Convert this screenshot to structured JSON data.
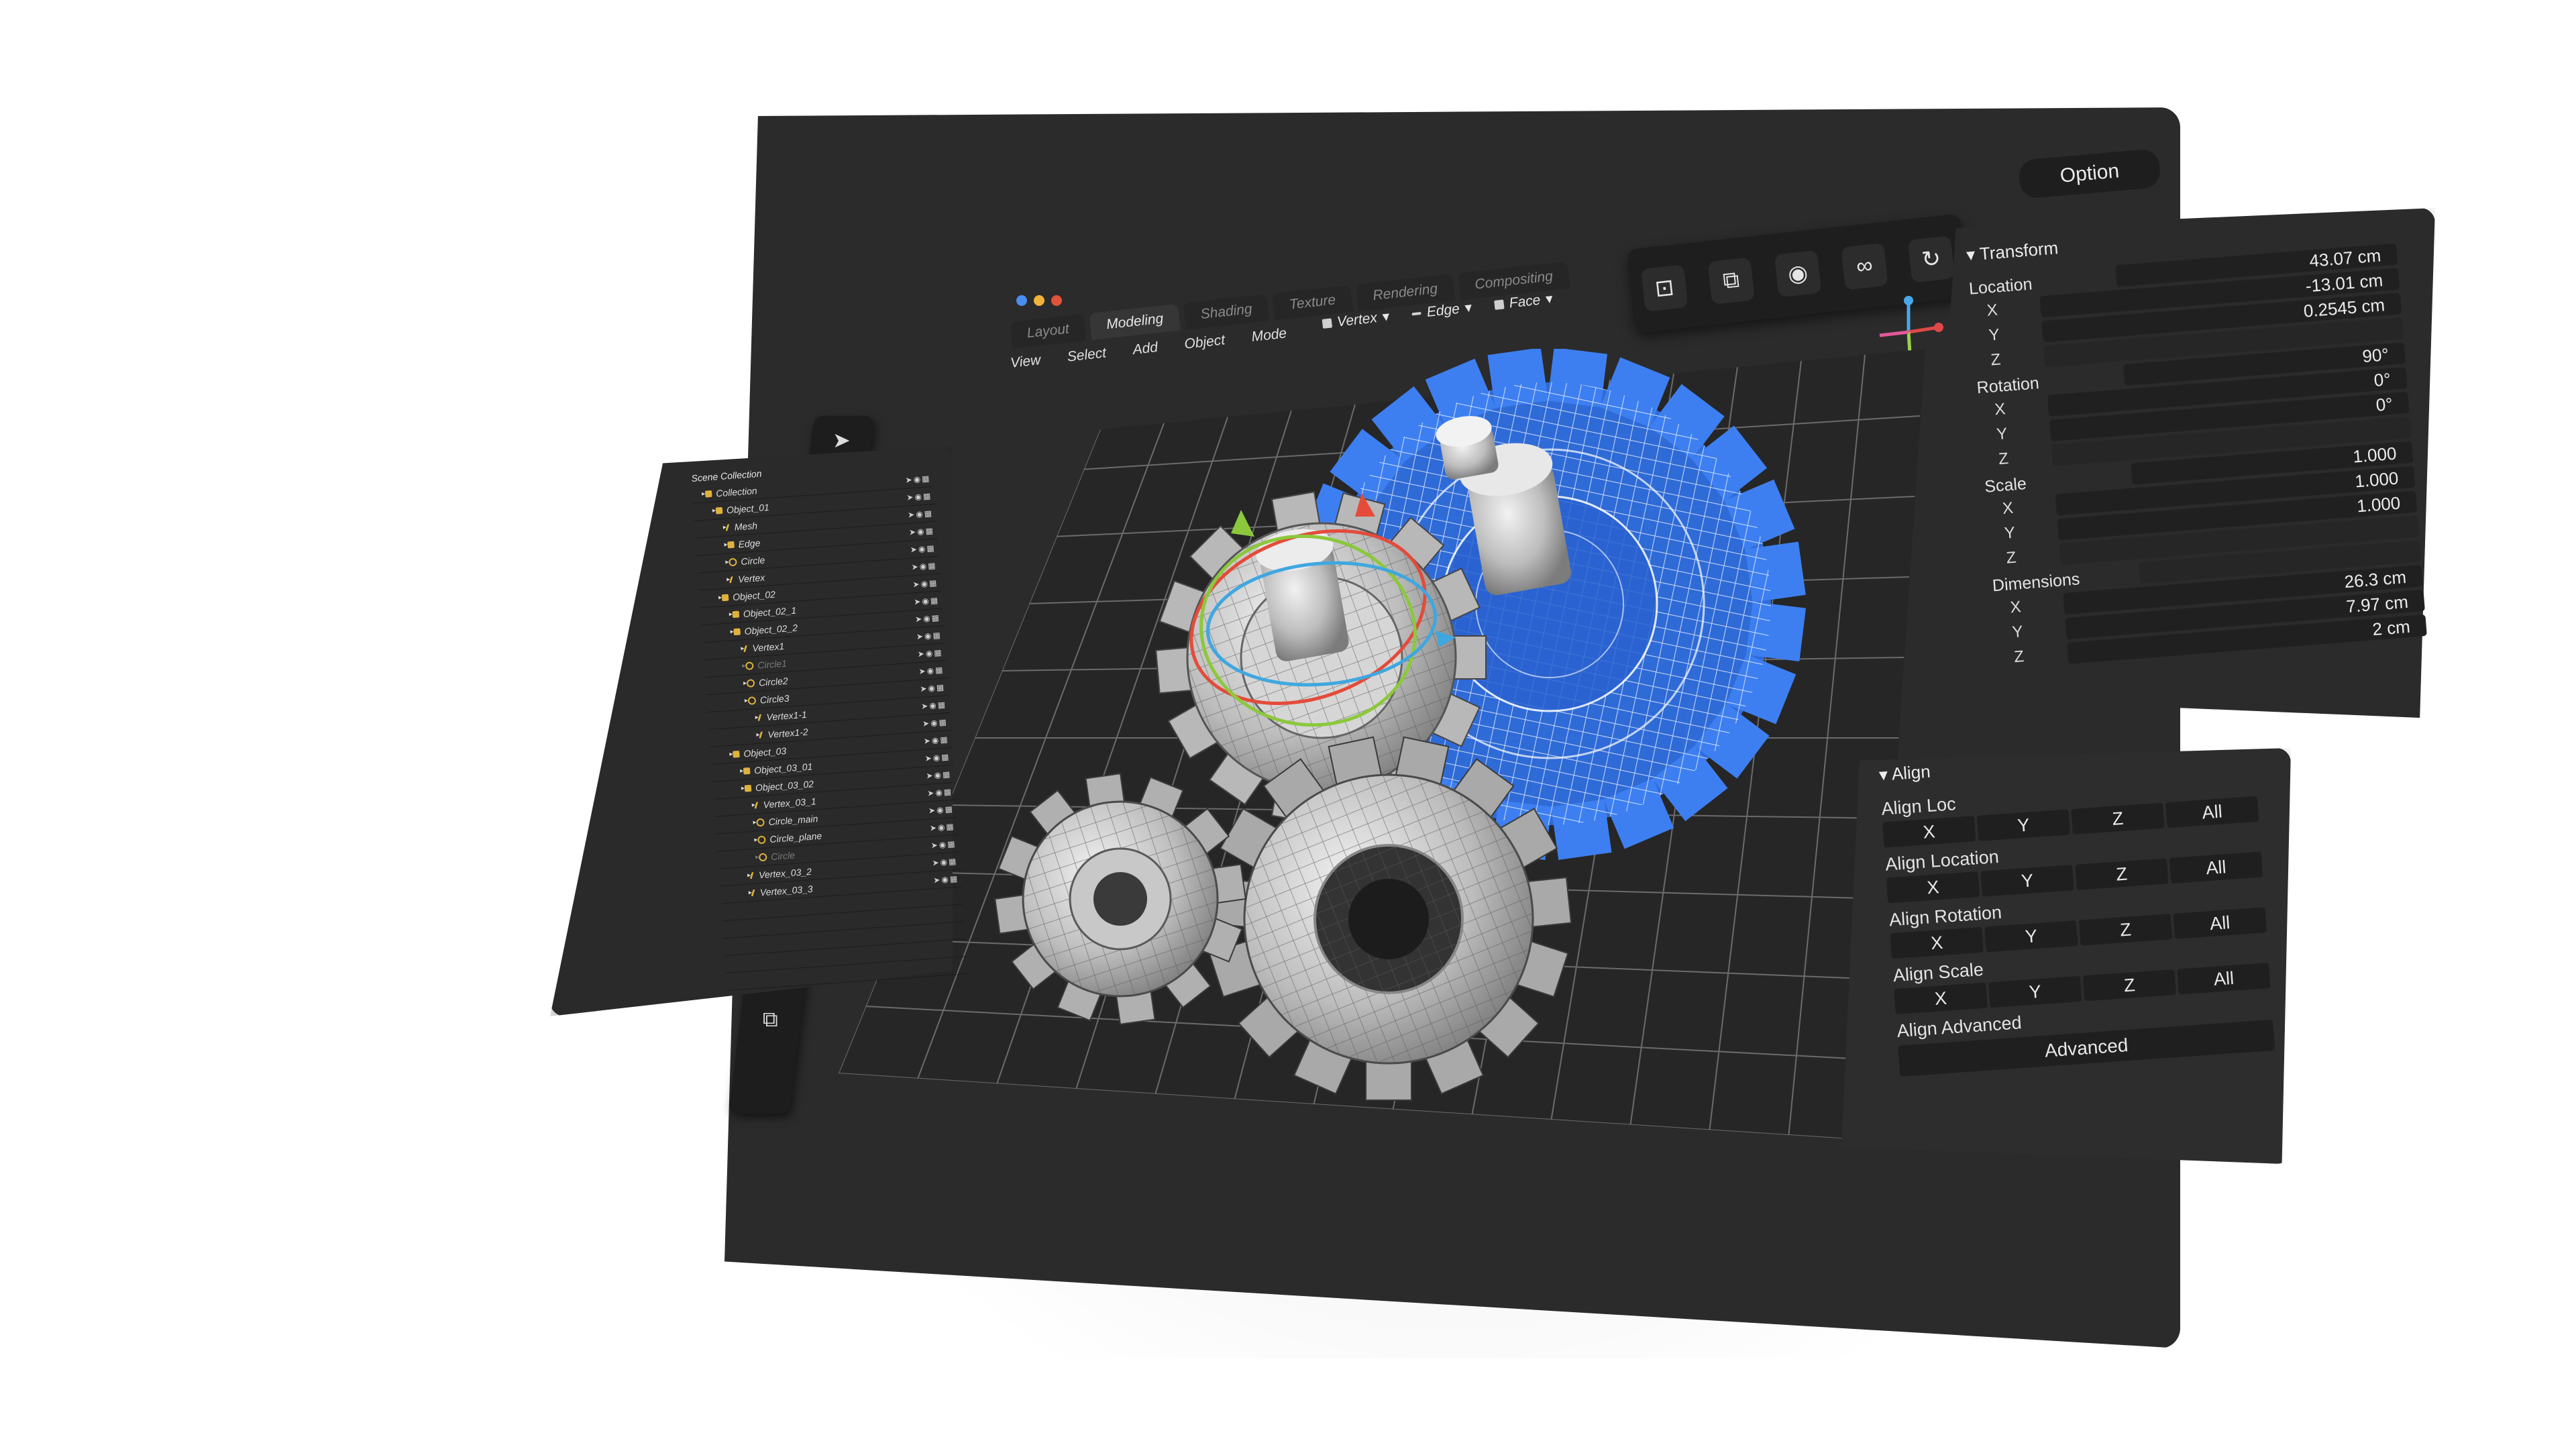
{
  "window": {
    "traffic_lights": [
      "#4a8ef0",
      "#f0b23a",
      "#e0523b"
    ],
    "tabs": [
      {
        "label": "Layout",
        "active": false
      },
      {
        "label": "Modeling",
        "active": true
      },
      {
        "label": "Shading",
        "active": false
      },
      {
        "label": "Texture",
        "active": false
      },
      {
        "label": "Rendering",
        "active": false
      },
      {
        "label": "Compositing",
        "active": false
      }
    ],
    "menus": [
      "View",
      "Select",
      "Add",
      "Object",
      "Mode"
    ],
    "select_modes": [
      "Vertex",
      "Edge",
      "Face"
    ],
    "option_label": "Option",
    "toolbar_icons": [
      "snap-icon",
      "proportional-icon",
      "pivot-icon",
      "link-icon",
      "refresh-icon"
    ]
  },
  "left_toolbar": {
    "icons": [
      "select-arrow-icon",
      "zoom-icon",
      "move-icon",
      "rotate-icon",
      "scale-icon",
      "transform-icon",
      "annotate-icon",
      "measure-icon",
      "extrude-icon",
      "bevel-icon",
      "knife-icon",
      "snap-icon",
      "duplicate-icon"
    ]
  },
  "scene_collection": {
    "title": "Scene Collection",
    "items": [
      {
        "label": "Collection",
        "icon": "folder",
        "dim": false
      },
      {
        "label": "Object_01",
        "icon": "folder",
        "dim": false
      },
      {
        "label": "Mesh",
        "icon": "vert",
        "dim": false
      },
      {
        "label": "Edge",
        "icon": "square",
        "dim": false
      },
      {
        "label": "Circle",
        "icon": "circle",
        "dim": false
      },
      {
        "label": "Vertex",
        "icon": "vert",
        "dim": false
      },
      {
        "label": "Object_02",
        "icon": "folder",
        "dim": false
      },
      {
        "label": "Object_02_1",
        "icon": "folder",
        "dim": false
      },
      {
        "label": "Object_02_2",
        "icon": "folder",
        "dim": false
      },
      {
        "label": "Vertex1",
        "icon": "vert",
        "dim": false
      },
      {
        "label": "Circle1",
        "icon": "circle",
        "dim": true
      },
      {
        "label": "Circle2",
        "icon": "circle",
        "dim": false
      },
      {
        "label": "Circle3",
        "icon": "circle",
        "dim": false
      },
      {
        "label": "Vertex1-1",
        "icon": "vert",
        "dim": false
      },
      {
        "label": "Vertex1-2",
        "icon": "vert",
        "dim": false
      },
      {
        "label": "Object_03",
        "icon": "folder",
        "dim": false
      },
      {
        "label": "Object_03_01",
        "icon": "folder",
        "dim": false
      },
      {
        "label": "Object_03_02",
        "icon": "folder",
        "dim": false
      },
      {
        "label": "Vertex_03_1",
        "icon": "vert",
        "dim": false
      },
      {
        "label": "Circle_main",
        "icon": "circle",
        "dim": false
      },
      {
        "label": "Circle_plane",
        "icon": "circle",
        "dim": false
      },
      {
        "label": "Circle",
        "icon": "circle",
        "dim": true
      },
      {
        "label": "Vertex_03_2",
        "icon": "vert",
        "dim": false
      },
      {
        "label": "Vertex_03_3",
        "icon": "vert",
        "dim": false
      }
    ]
  },
  "transform": {
    "title": "Transform",
    "location": {
      "label": "Location",
      "x": "43.07 cm",
      "y": "-13.01 cm",
      "z": "0.2545 cm"
    },
    "rotation": {
      "label": "Rotation",
      "x": "90°",
      "y": "0°",
      "z": "0°"
    },
    "scale": {
      "label": "Scale",
      "x": "1.000",
      "y": "1.000",
      "z": "1.000"
    },
    "dimensions": {
      "label": "Dimensions",
      "x": "26.3 cm",
      "y": "7.97 cm",
      "z": "2 cm"
    },
    "axis_labels": [
      "X",
      "Y",
      "Z"
    ]
  },
  "align": {
    "title": "Align",
    "groups": [
      {
        "label": "Align Loc",
        "buttons": [
          "X",
          "Y",
          "Z",
          "All"
        ]
      },
      {
        "label": "Align Location",
        "buttons": [
          "X",
          "Y",
          "Z",
          "All"
        ]
      },
      {
        "label": "Align Rotation",
        "buttons": [
          "X",
          "Y",
          "Z",
          "All"
        ]
      },
      {
        "label": "Align Scale",
        "buttons": [
          "X",
          "Y",
          "Z",
          "All"
        ]
      }
    ],
    "advanced": {
      "label": "Align Advanced",
      "button": "Advanced"
    }
  },
  "colors": {
    "panel": "#2b2b2b",
    "wire_blue": "#2f6fe0",
    "gear_grey": "#c9c9c9",
    "folder_yellow": "#e0b23c"
  }
}
